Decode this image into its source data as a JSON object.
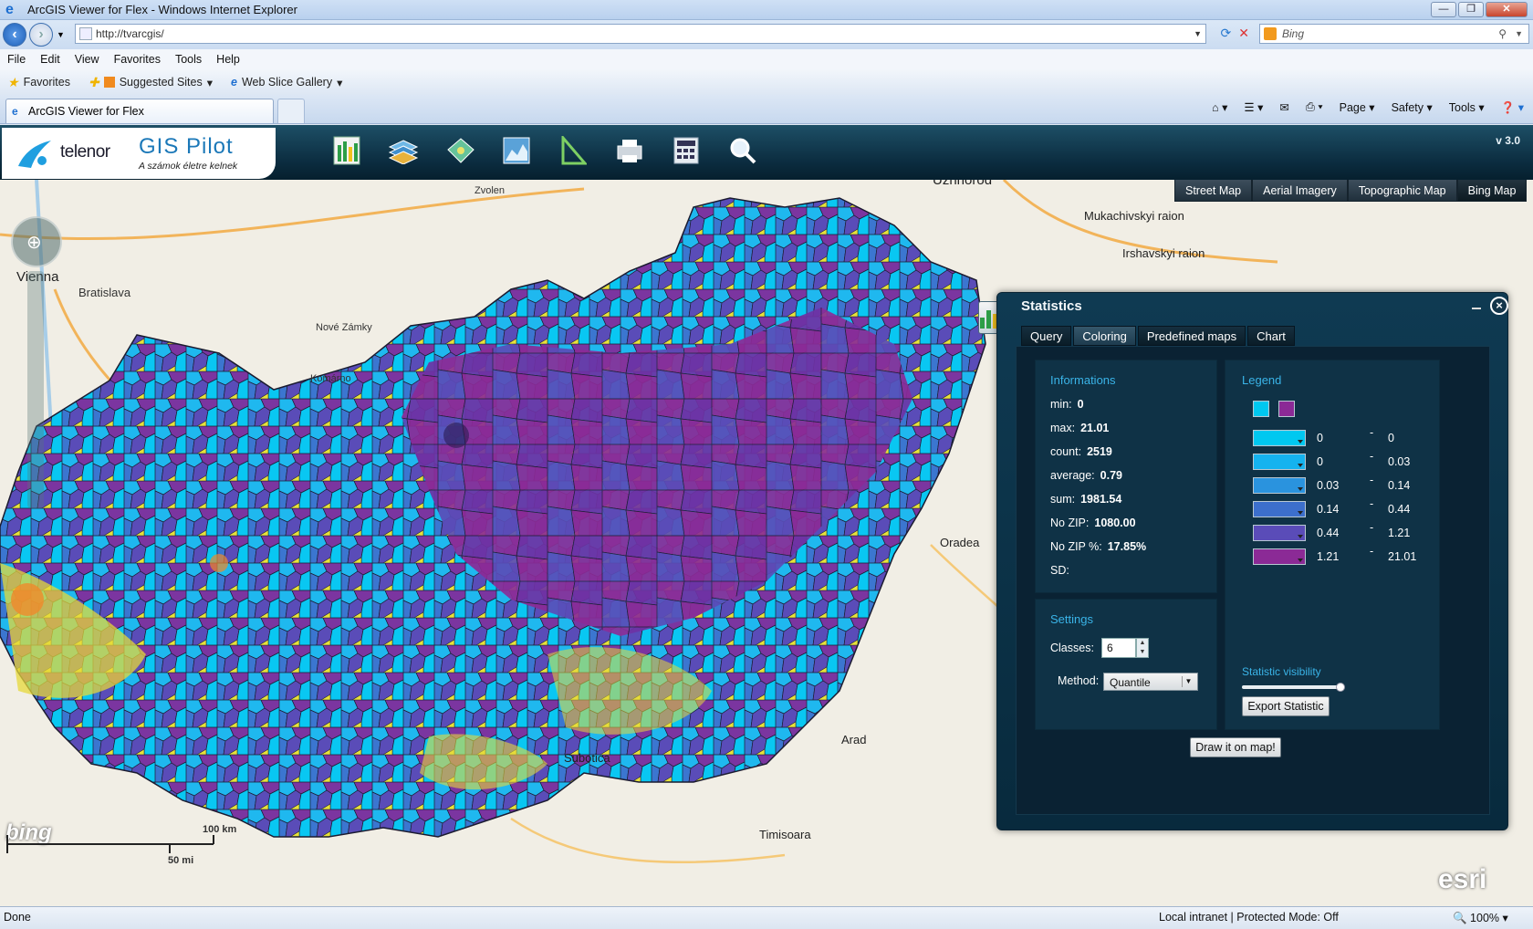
{
  "window": {
    "title": "ArcGIS Viewer for Flex - Windows Internet Explorer"
  },
  "browser": {
    "address": "http://tvarcgis/",
    "search_placeholder": "Bing",
    "menu": [
      "File",
      "Edit",
      "View",
      "Favorites",
      "Tools",
      "Help"
    ],
    "favorites": {
      "favorites_label": "Favorites",
      "suggested": "Suggested Sites",
      "webslice": "Web Slice Gallery"
    },
    "tab_title": "ArcGIS Viewer for Flex",
    "commands": {
      "page": "Page",
      "safety": "Safety",
      "tools": "Tools"
    }
  },
  "app": {
    "brand": "telenor",
    "product": "GIS Pilot",
    "tagline": "A számok életre kelnek",
    "version": "v 3.0",
    "toolbar_icons": [
      "statistics-icon",
      "layers-icon",
      "map-overlay-icon",
      "chart-area-icon",
      "measure-icon",
      "print-icon",
      "calculator-icon",
      "search-icon"
    ],
    "basemaps": [
      {
        "label": "Street Map",
        "active": false
      },
      {
        "label": "Aerial Imagery",
        "active": false
      },
      {
        "label": "Topographic Map",
        "active": false
      },
      {
        "label": "Bing Map",
        "active": true
      }
    ],
    "scale": {
      "km": "100 km",
      "mi": "50 mi"
    },
    "map_labels": [
      {
        "text": "Vienna",
        "big": true
      },
      {
        "text": "Bratislava",
        "big": false
      },
      {
        "text": "Uzhhorod",
        "big": true
      },
      {
        "text": "Mukachivskyi raion",
        "big": true
      },
      {
        "text": "Irshavskyi raion",
        "big": true
      },
      {
        "text": "Oradea",
        "big": true
      },
      {
        "text": "Arad",
        "big": true
      },
      {
        "text": "Subotica",
        "big": true
      },
      {
        "text": "Timisoara",
        "big": true
      },
      {
        "text": "Zvolen",
        "big": false
      },
      {
        "text": "Komárno",
        "big": false
      },
      {
        "text": "Nové Zámky",
        "big": false
      }
    ]
  },
  "statistics": {
    "title": "Statistics",
    "tabs": [
      {
        "label": "Query",
        "active": false
      },
      {
        "label": "Coloring",
        "active": true
      },
      {
        "label": "Predefined maps",
        "active": false
      },
      {
        "label": "Chart",
        "active": false
      }
    ],
    "info_heading": "Informations",
    "info": [
      {
        "label": "min:",
        "value": "0"
      },
      {
        "label": "max:",
        "value": "21.01"
      },
      {
        "label": "count:",
        "value": "2519"
      },
      {
        "label": "average:",
        "value": "0.79"
      },
      {
        "label": "sum:",
        "value": "1981.54"
      },
      {
        "label": "No ZIP:",
        "value": "1080.00"
      },
      {
        "label": "No ZIP %:",
        "value": "17.85%"
      },
      {
        "label": "SD:",
        "value": ""
      }
    ],
    "legend_heading": "Legend",
    "legend_endpoints": [
      "#00c8f0",
      "#8b2a96"
    ],
    "legend": [
      {
        "color": "#00c8f0",
        "lo": "0",
        "hi": "0"
      },
      {
        "color": "#15b3ef",
        "lo": "0",
        "hi": "0.03"
      },
      {
        "color": "#2a93de",
        "lo": "0.03",
        "hi": "0.14"
      },
      {
        "color": "#3c6fcc",
        "lo": "0.14",
        "hi": "0.44"
      },
      {
        "color": "#5a4cb8",
        "lo": "0.44",
        "hi": "1.21"
      },
      {
        "color": "#8b2a96",
        "lo": "1.21",
        "hi": "21.01"
      }
    ],
    "range_dash": "-",
    "settings_heading": "Settings",
    "classes_label": "Classes:",
    "classes_value": "6",
    "method_label": "Method:",
    "method_value": "Quantile",
    "visibility_label": "Statistic visibility",
    "visibility": 0.98,
    "export_label": "Export Statistic",
    "draw_label": "Draw it on map!"
  },
  "status": {
    "left": "Done",
    "zone": "Local intranet | Protected Mode: Off",
    "zoom": "100%"
  }
}
